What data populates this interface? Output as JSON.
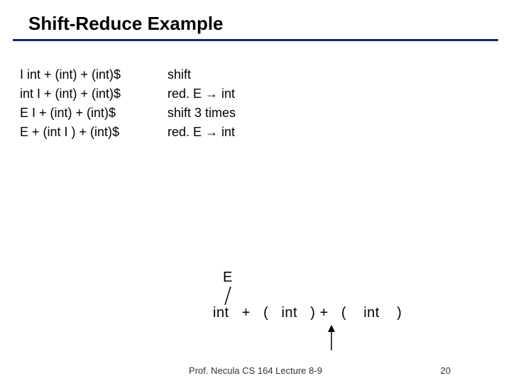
{
  "title": "Shift-Reduce Example",
  "rows": [
    {
      "left": "| int + (int) + (int)$",
      "right": "shift"
    },
    {
      "left": "int | + (int) + (int)$",
      "right": "red. E → int"
    },
    {
      "left": "E | + (int) + (int)$",
      "right": "shift 3 times"
    },
    {
      "left": "E + (int | ) + (int)$",
      "right": "red. E → int"
    }
  ],
  "tree": {
    "parent": "E",
    "tokens": "int   +   (   int   ) +   (    int    )"
  },
  "footer": {
    "center": "Prof. Necula  CS 164  Lecture 8-9",
    "pageno": "20"
  }
}
